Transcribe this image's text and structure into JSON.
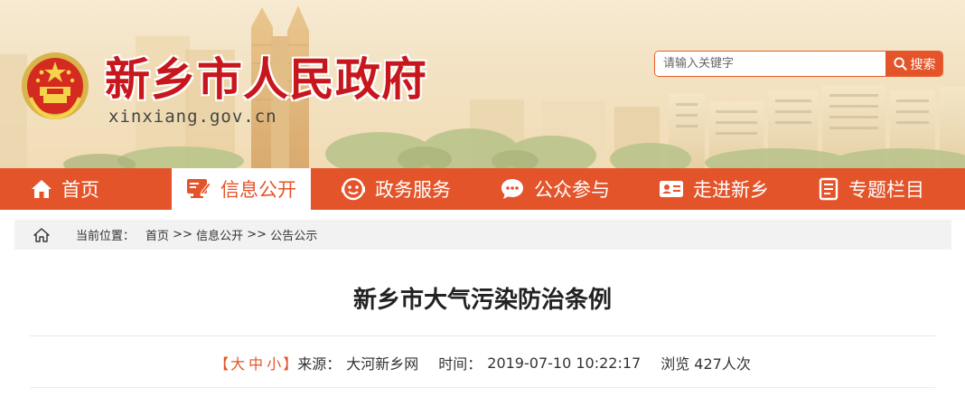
{
  "header": {
    "site_title": "新乡市人民政府",
    "site_domain": "xinxiang.gov.cn"
  },
  "search": {
    "placeholder": "请输入关键字",
    "button_label": "搜索"
  },
  "nav": {
    "items": [
      {
        "label": "首页",
        "icon": "home-icon"
      },
      {
        "label": "信息公开",
        "icon": "monitor-edit-icon",
        "active": true
      },
      {
        "label": "政务服务",
        "icon": "service-icon"
      },
      {
        "label": "公众参与",
        "icon": "chat-icon"
      },
      {
        "label": "走进新乡",
        "icon": "id-card-icon"
      },
      {
        "label": "专题栏目",
        "icon": "document-icon"
      }
    ]
  },
  "breadcrumb": {
    "prefix": "当前位置：",
    "items": [
      "首页",
      "信息公开",
      "公告公示"
    ],
    "separator": ">>"
  },
  "article": {
    "title": "新乡市大气污染防治条例",
    "font_size": {
      "open": "【",
      "large": "大",
      "medium": "中",
      "small": "小",
      "close": "】"
    },
    "source_label": "来源：",
    "source_value": "大河新乡网",
    "time_label": "时间：",
    "time_value": "2019-07-10 10:22:17",
    "views_text": "浏览 427人次"
  },
  "colors": {
    "accent": "#e4542a",
    "title_red": "#c8161d"
  }
}
